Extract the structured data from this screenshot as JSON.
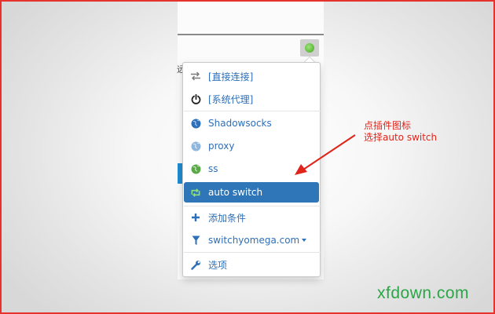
{
  "menu": {
    "items": [
      {
        "label": "[直接连接]",
        "icon": "direct-connect-arrows-icon"
      },
      {
        "label": "[系统代理]",
        "icon": "power-icon"
      },
      {
        "label": "Shadowsocks",
        "icon": "globe-icon"
      },
      {
        "label": "proxy",
        "icon": "globe-icon"
      },
      {
        "label": "ss",
        "icon": "globe-icon"
      },
      {
        "label": "auto switch",
        "icon": "retweet-icon",
        "active": true
      },
      {
        "label": "添加条件",
        "icon": "plus-icon"
      },
      {
        "label": "switchyomega.com",
        "icon": "filter-icon"
      },
      {
        "label": "选项",
        "icon": "wrench-icon"
      }
    ]
  },
  "annotation": {
    "line1": "点插件图标",
    "line2": "选择auto switch"
  },
  "watermark": "xfdown.com",
  "edge_text": "远",
  "colors": {
    "accent": "#2f76b8",
    "link": "#2d6fb8",
    "annotation": "#e0241b",
    "watermark": "#2aa646",
    "extension_icon": "#43a61e"
  }
}
